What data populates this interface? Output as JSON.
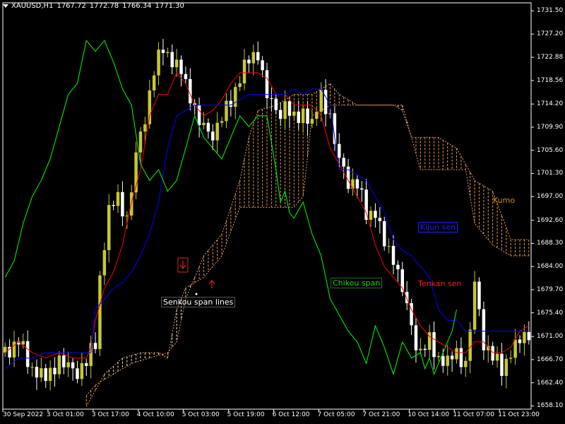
{
  "header": {
    "symbol": "XAUUSD,H1",
    "open": "1767.72",
    "high": "1772.78",
    "low": "1766.34",
    "close": "1771.30"
  },
  "colors": {
    "background": "#000000",
    "frame": "#ffffff",
    "bull_candle": "#c8c832",
    "bear_candle": "#ffffff",
    "tenkan": "#ff0000",
    "kijun": "#0000ff",
    "chikou": "#00ff00",
    "kumo_bull": "#ffa860",
    "kumo_bear": "#ffffff",
    "kumo_label": "#d28b26"
  },
  "icons": [
    "dropdown-triangle-icon",
    "down-arrow-marker-icon",
    "up-arrow-marker-icon"
  ],
  "chart_data": {
    "type": "candlestick",
    "indicator": "Ichimoku Kinko Hyo",
    "ylim": [
      1657.5,
      1733.0
    ],
    "y_ticks": [
      "1731.50",
      "1727.20",
      "1722.88",
      "1718.56",
      "1714.20",
      "1709.90",
      "1705.60",
      "1701.30",
      "1697.00",
      "1692.60",
      "1688.30",
      "1684.00",
      "1679.70",
      "1675.40",
      "1671.00",
      "1666.70",
      "1662.40",
      "1658.10"
    ],
    "x_ticks": [
      "30 Sep 2022",
      "3 Oct 01:00",
      "3 Oct 17:00",
      "4 Oct 10:00",
      "5 Oct 03:00",
      "5 Oct 19:00",
      "6 Oct 12:00",
      "7 Oct 05:00",
      "7 Oct 21:00",
      "10 Oct 14:00",
      "11 Oct 07:00",
      "11 Oct 23:00"
    ],
    "x_tick_index": [
      0,
      10,
      20,
      30,
      40,
      50,
      60,
      70,
      80,
      90,
      100,
      110
    ],
    "bar_count": 117,
    "labels": {
      "tenkan": "Tenkan sen",
      "kijun": "Kijun sen",
      "chikou": "Chikou span",
      "kumo": "Kumo",
      "senkou": "Senkou span lines"
    },
    "close_path": [
      [
        0,
        1668
      ],
      [
        3,
        1670
      ],
      [
        6,
        1665
      ],
      [
        9,
        1663
      ],
      [
        12,
        1667
      ],
      [
        15,
        1664
      ],
      [
        18,
        1666
      ],
      [
        20,
        1670
      ],
      [
        21,
        1682
      ],
      [
        23,
        1694
      ],
      [
        25,
        1697
      ],
      [
        27,
        1693
      ],
      [
        29,
        1704
      ],
      [
        31,
        1712
      ],
      [
        33,
        1720
      ],
      [
        35,
        1725
      ],
      [
        37,
        1722
      ],
      [
        39,
        1720
      ],
      [
        41,
        1716
      ],
      [
        43,
        1711
      ],
      [
        45,
        1708
      ],
      [
        47,
        1710
      ],
      [
        49,
        1713
      ],
      [
        51,
        1717
      ],
      [
        53,
        1721
      ],
      [
        55,
        1723
      ],
      [
        56,
        1724
      ],
      [
        58,
        1716
      ],
      [
        60,
        1712
      ],
      [
        62,
        1714
      ],
      [
        64,
        1711
      ],
      [
        66,
        1713
      ],
      [
        68,
        1710
      ],
      [
        70,
        1716
      ],
      [
        72,
        1712
      ],
      [
        74,
        1703
      ],
      [
        76,
        1700
      ],
      [
        78,
        1699
      ],
      [
        80,
        1694
      ],
      [
        82,
        1694
      ],
      [
        84,
        1688
      ],
      [
        86,
        1686
      ],
      [
        88,
        1680
      ],
      [
        90,
        1672
      ],
      [
        92,
        1668
      ],
      [
        94,
        1670
      ],
      [
        96,
        1667
      ],
      [
        98,
        1666
      ],
      [
        100,
        1668
      ],
      [
        102,
        1666
      ],
      [
        104,
        1680
      ],
      [
        106,
        1670
      ],
      [
        108,
        1667
      ],
      [
        110,
        1665
      ],
      [
        112,
        1668
      ],
      [
        114,
        1670
      ],
      [
        116,
        1672
      ]
    ],
    "series": [
      {
        "name": "Tenkan sen",
        "values": [
          [
            0,
            1668
          ],
          [
            3,
            1670
          ],
          [
            6,
            1668
          ],
          [
            9,
            1667
          ],
          [
            12,
            1668
          ],
          [
            15,
            1667
          ],
          [
            18,
            1667
          ],
          [
            19,
            1669
          ],
          [
            20,
            1674
          ],
          [
            22,
            1680
          ],
          [
            24,
            1683
          ],
          [
            26,
            1688
          ],
          [
            28,
            1696
          ],
          [
            30,
            1702
          ],
          [
            32,
            1712
          ],
          [
            34,
            1716
          ],
          [
            36,
            1716
          ],
          [
            38,
            1720
          ],
          [
            40,
            1718
          ],
          [
            42,
            1714
          ],
          [
            44,
            1712
          ],
          [
            46,
            1713
          ],
          [
            48,
            1715
          ],
          [
            50,
            1718
          ],
          [
            52,
            1720
          ],
          [
            54,
            1720
          ],
          [
            56,
            1720
          ],
          [
            58,
            1719
          ],
          [
            60,
            1716
          ],
          [
            62,
            1716
          ],
          [
            64,
            1714
          ],
          [
            66,
            1714
          ],
          [
            68,
            1714
          ],
          [
            70,
            1712
          ],
          [
            72,
            1706
          ],
          [
            74,
            1703
          ],
          [
            76,
            1700
          ],
          [
            78,
            1697
          ],
          [
            80,
            1694
          ],
          [
            82,
            1688
          ],
          [
            84,
            1684
          ],
          [
            86,
            1682
          ],
          [
            88,
            1680
          ],
          [
            90,
            1676
          ],
          [
            92,
            1673
          ],
          [
            94,
            1671
          ],
          [
            96,
            1670
          ],
          [
            98,
            1669
          ],
          [
            100,
            1668
          ],
          [
            102,
            1668
          ],
          [
            104,
            1670
          ],
          [
            106,
            1670
          ],
          [
            108,
            1668
          ],
          [
            110,
            1668
          ],
          [
            112,
            1669
          ],
          [
            114,
            1672
          ],
          [
            116,
            1673
          ]
        ]
      },
      {
        "name": "Kijun sen",
        "values": [
          [
            0,
            1665
          ],
          [
            3,
            1667
          ],
          [
            6,
            1667
          ],
          [
            9,
            1668
          ],
          [
            12,
            1668
          ],
          [
            15,
            1668
          ],
          [
            18,
            1668
          ],
          [
            19,
            1668
          ],
          [
            20,
            1676
          ],
          [
            22,
            1678
          ],
          [
            24,
            1680
          ],
          [
            26,
            1681
          ],
          [
            28,
            1683
          ],
          [
            30,
            1686
          ],
          [
            32,
            1690
          ],
          [
            34,
            1696
          ],
          [
            36,
            1706
          ],
          [
            38,
            1712
          ],
          [
            40,
            1713
          ],
          [
            42,
            1714
          ],
          [
            44,
            1714
          ],
          [
            46,
            1714
          ],
          [
            48,
            1714
          ],
          [
            50,
            1714
          ],
          [
            52,
            1715
          ],
          [
            54,
            1716
          ],
          [
            56,
            1716
          ],
          [
            58,
            1716
          ],
          [
            60,
            1716
          ],
          [
            62,
            1716
          ],
          [
            64,
            1717
          ],
          [
            66,
            1716
          ],
          [
            68,
            1717
          ],
          [
            70,
            1717
          ],
          [
            72,
            1714
          ],
          [
            74,
            1702
          ],
          [
            76,
            1702
          ],
          [
            78,
            1701
          ],
          [
            80,
            1700
          ],
          [
            82,
            1697
          ],
          [
            84,
            1694
          ],
          [
            86,
            1689
          ],
          [
            88,
            1687
          ],
          [
            90,
            1686
          ],
          [
            92,
            1684
          ],
          [
            94,
            1682
          ],
          [
            96,
            1676
          ],
          [
            98,
            1674
          ],
          [
            100,
            1674
          ],
          [
            102,
            1672
          ],
          [
            104,
            1672
          ],
          [
            106,
            1672
          ],
          [
            108,
            1672
          ],
          [
            110,
            1672
          ],
          [
            112,
            1672
          ],
          [
            114,
            1672
          ],
          [
            116,
            1672
          ]
        ]
      },
      {
        "name": "Chikou span",
        "values": [
          [
            0,
            1682
          ],
          [
            2,
            1685
          ],
          [
            4,
            1692
          ],
          [
            6,
            1697
          ],
          [
            8,
            1700
          ],
          [
            10,
            1704
          ],
          [
            12,
            1710
          ],
          [
            14,
            1716
          ],
          [
            16,
            1718
          ],
          [
            17,
            1722
          ],
          [
            18,
            1726
          ],
          [
            19,
            1725
          ],
          [
            20,
            1724
          ],
          [
            22,
            1726
          ],
          [
            24,
            1722
          ],
          [
            26,
            1717
          ],
          [
            28,
            1714
          ],
          [
            30,
            1703
          ],
          [
            32,
            1700
          ],
          [
            34,
            1702
          ],
          [
            36,
            1698
          ],
          [
            38,
            1700
          ],
          [
            40,
            1706
          ],
          [
            42,
            1712
          ],
          [
            44,
            1708
          ],
          [
            46,
            1706
          ],
          [
            48,
            1704
          ],
          [
            50,
            1708
          ],
          [
            52,
            1712
          ],
          [
            54,
            1710
          ],
          [
            56,
            1712
          ],
          [
            58,
            1712
          ],
          [
            60,
            1702
          ],
          [
            61,
            1696
          ],
          [
            62,
            1698
          ],
          [
            63,
            1694
          ],
          [
            64,
            1693
          ],
          [
            66,
            1696
          ],
          [
            68,
            1690
          ],
          [
            70,
            1686
          ],
          [
            72,
            1678
          ],
          [
            74,
            1675
          ],
          [
            76,
            1672
          ],
          [
            78,
            1670
          ],
          [
            80,
            1666
          ],
          [
            82,
            1673
          ],
          [
            84,
            1669
          ],
          [
            86,
            1664
          ],
          [
            88,
            1670
          ],
          [
            90,
            1667
          ],
          [
            92,
            1668
          ],
          [
            93,
            1665
          ],
          [
            94,
            1667
          ],
          [
            95,
            1664
          ],
          [
            96,
            1666
          ],
          [
            97,
            1668
          ],
          [
            98,
            1670
          ],
          [
            99,
            1672
          ],
          [
            100,
            1676
          ]
        ]
      },
      {
        "name": "Senkou span A",
        "values": [
          [
            18,
            1660
          ],
          [
            20,
            1662
          ],
          [
            24,
            1664
          ],
          [
            28,
            1666
          ],
          [
            32,
            1667
          ],
          [
            36,
            1668
          ],
          [
            38,
            1670
          ],
          [
            40,
            1678
          ],
          [
            44,
            1686
          ],
          [
            48,
            1690
          ],
          [
            50,
            1695
          ],
          [
            52,
            1700
          ],
          [
            54,
            1708
          ],
          [
            56,
            1713
          ],
          [
            60,
            1714
          ],
          [
            64,
            1716
          ],
          [
            68,
            1716
          ],
          [
            72,
            1718
          ],
          [
            74,
            1716
          ],
          [
            78,
            1714
          ],
          [
            82,
            1714
          ],
          [
            86,
            1714
          ],
          [
            88,
            1713
          ],
          [
            90,
            1708
          ],
          [
            92,
            1708
          ],
          [
            96,
            1708
          ],
          [
            100,
            1706
          ],
          [
            104,
            1700
          ],
          [
            108,
            1698
          ],
          [
            112,
            1689
          ],
          [
            116,
            1689
          ]
        ]
      },
      {
        "name": "Senkou span B",
        "values": [
          [
            18,
            1658
          ],
          [
            22,
            1664
          ],
          [
            26,
            1667
          ],
          [
            30,
            1668
          ],
          [
            34,
            1668
          ],
          [
            36,
            1667
          ],
          [
            38,
            1676
          ],
          [
            40,
            1680
          ],
          [
            44,
            1682
          ],
          [
            48,
            1686
          ],
          [
            52,
            1695
          ],
          [
            56,
            1695
          ],
          [
            60,
            1695
          ],
          [
            64,
            1695
          ],
          [
            66,
            1697
          ],
          [
            68,
            1712
          ],
          [
            72,
            1714
          ],
          [
            76,
            1714
          ],
          [
            80,
            1714
          ],
          [
            84,
            1714
          ],
          [
            88,
            1714
          ],
          [
            92,
            1702
          ],
          [
            96,
            1702
          ],
          [
            100,
            1702
          ],
          [
            102,
            1702
          ],
          [
            104,
            1692
          ],
          [
            108,
            1688
          ],
          [
            112,
            1686
          ],
          [
            116,
            1686
          ]
        ]
      }
    ]
  }
}
